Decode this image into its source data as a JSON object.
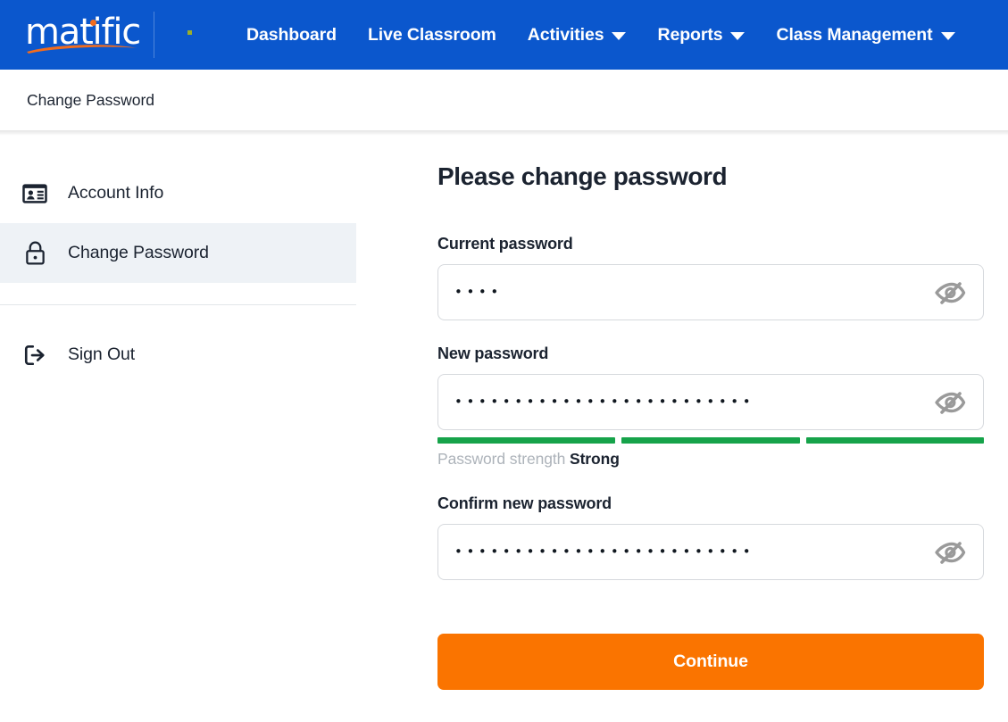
{
  "brand": {
    "logo_text": "matific",
    "logo_dot_color": "#f26c1e",
    "logo_swoosh_color": "#f26c1e",
    "header_bg": "#0b57cd",
    "accent_orange": "#fa7400",
    "mini_dot_color": "#9aae2b"
  },
  "nav": {
    "items": [
      {
        "label": "Dashboard",
        "has_caret": false,
        "icon": ""
      },
      {
        "label": "Live Classroom",
        "has_caret": false,
        "icon": ""
      },
      {
        "label": "Activities",
        "has_caret": true,
        "icon": "chevron-down-icon"
      },
      {
        "label": "Reports",
        "has_caret": true,
        "icon": "chevron-down-icon"
      },
      {
        "label": "Class Management",
        "has_caret": true,
        "icon": "chevron-down-icon"
      }
    ]
  },
  "breadcrumb": {
    "text": "Change Password"
  },
  "sidebar": {
    "items": [
      {
        "label": "Account Info",
        "icon": "id-card-icon",
        "active": false
      },
      {
        "label": "Change Password",
        "icon": "lock-icon",
        "active": true
      },
      {
        "label": "Sign Out",
        "icon": "sign-out-icon",
        "active": false
      }
    ]
  },
  "form": {
    "title": "Please change password",
    "fields": [
      {
        "label": "Current password",
        "value": "••••",
        "masked_char_count": 4,
        "reveal_icon": "eye-off-icon"
      },
      {
        "label": "New password",
        "value": "•••••••••••••••••••••••••",
        "masked_char_count": 25,
        "reveal_icon": "eye-off-icon"
      },
      {
        "label": "Confirm new password",
        "value": "•••••••••••••••••••••••••",
        "masked_char_count": 25,
        "reveal_icon": "eye-off-icon"
      }
    ],
    "strength": {
      "caption_prefix": "Password strength",
      "level_label": "Strong",
      "segments_total": 3,
      "segments_filled": 3,
      "filled_color": "#16a34a",
      "empty_color": "#e3e6e8"
    },
    "submit_label": "Continue"
  }
}
